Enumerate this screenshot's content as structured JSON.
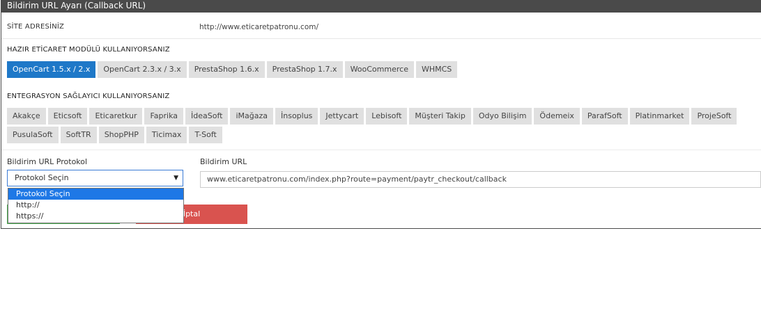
{
  "panel": {
    "title": "Bildirim URL Ayarı (Callback URL)"
  },
  "site": {
    "label": "SİTE ADRESİNİZ",
    "value": "http://www.eticaretpatronu.com/"
  },
  "modules": {
    "title": "HAZIR ETİCARET MODÜLÜ KULLANIYORSANIZ",
    "items": [
      "OpenCart 1.5.x / 2.x",
      "OpenCart 2.3.x / 3.x",
      "PrestaShop 1.6.x",
      "PrestaShop 1.7.x",
      "WooCommerce",
      "WHMCS"
    ],
    "active_index": 0
  },
  "providers": {
    "title": "ENTEGRASYON SAĞLAYICI KULLANIYORSANIZ",
    "items": [
      "Akakçe",
      "Eticsoft",
      "Eticaretkur",
      "Faprika",
      "İdeaSoft",
      "iMağaza",
      "İnsoplus",
      "Jettycart",
      "Lebisoft",
      "Müşteri Takip",
      "Odyo Bilişim",
      "Ödemeix",
      "ParafSoft",
      "Platinmarket",
      "ProjeSoft",
      "PusulaSoft",
      "SoftTR",
      "ShopPHP",
      "Ticimax",
      "T-Soft"
    ]
  },
  "protocol": {
    "label": "Bildirim URL Protokol",
    "selected": "Protokol Seçin",
    "options": [
      "Protokol Seçin",
      "http://",
      "https://"
    ]
  },
  "callback_url": {
    "label": "Bildirim URL",
    "value": "www.eticaretpatronu.com/index.php?route=payment/paytr_checkout/callback"
  },
  "actions": {
    "cancel_label": "İptal"
  },
  "colors": {
    "header": "#4a4a4a",
    "active": "#1e78c8",
    "save": "#4caf50",
    "cancel": "#d9534f"
  }
}
